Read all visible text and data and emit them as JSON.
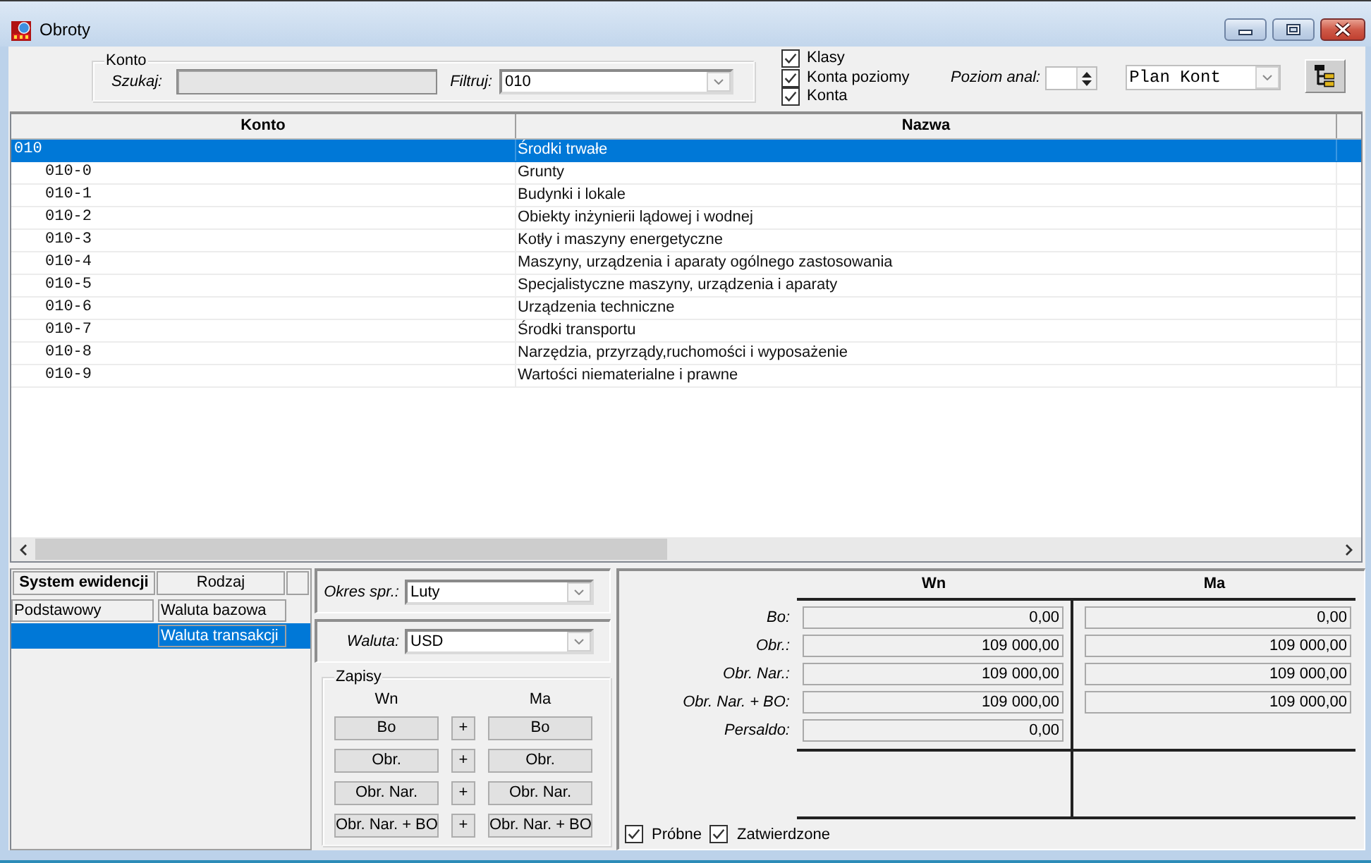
{
  "window": {
    "title": "Obroty"
  },
  "filter_bar": {
    "group": "Konto",
    "search": {
      "label": "Szukaj:",
      "disabled": true
    },
    "filter": {
      "label": "Filtruj:",
      "value": "010"
    },
    "checkboxes": [
      {
        "label": "Klasy",
        "checked": true
      },
      {
        "label": "Konta poziomy",
        "checked": true
      },
      {
        "label": "Konta",
        "checked": true
      }
    ],
    "analysis_level": {
      "label": "Poziom anal:"
    },
    "plan_select": {
      "value": "Plan Kont"
    }
  },
  "table": {
    "columns": [
      "Konto",
      "Nazwa"
    ],
    "rows": [
      {
        "account": "010",
        "name": "Środki trwałe",
        "selected": true,
        "children": [
          {
            "account": "010-0",
            "name": "Grunty",
            "selected": false
          },
          {
            "account": "010-1",
            "name": "Budynki i lokale",
            "selected": false
          },
          {
            "account": "010-2",
            "name": "Obiekty inżynierii lądowej i wodnej",
            "selected": false
          },
          {
            "account": "010-3",
            "name": "Kotły i maszyny energetyczne",
            "selected": false
          },
          {
            "account": "010-4",
            "name": "Maszyny, urządzenia i aparaty ogólnego zastosowania",
            "selected": false
          },
          {
            "account": "010-5",
            "name": "Specjalistyczne maszyny, urządzenia i aparaty",
            "selected": false
          },
          {
            "account": "010-6",
            "name": "Urządzenia techniczne",
            "selected": false
          },
          {
            "account": "010-7",
            "name": "Środki transportu",
            "selected": false
          },
          {
            "account": "010-8",
            "name": "Narzędzia, przyrządy,ruchomości i wyposażenie",
            "selected": false
          },
          {
            "account": "010-9",
            "name": "Wartości niematerialne i prawne",
            "selected": false
          }
        ]
      }
    ]
  },
  "record_systems": {
    "columns": [
      "System ewidencji",
      "Rodzaj"
    ],
    "rows": [
      {
        "system": "Podstawowy",
        "kinds": [
          {
            "label": "Waluta bazowa",
            "selected": false
          },
          {
            "label": "Waluta transakcji",
            "selected": true
          }
        ]
      }
    ]
  },
  "period": {
    "label": "Okres spr.:",
    "value": "Luty"
  },
  "currency": {
    "label": "Waluta:",
    "value": "USD"
  },
  "entries": {
    "title": "Zapisy",
    "columns": [
      "Wn",
      "Ma"
    ],
    "rows": [
      {
        "wn": "Bo",
        "join": "+",
        "ma": "Bo"
      },
      {
        "wn": "Obr.",
        "join": "+",
        "ma": "Obr."
      },
      {
        "wn": "Obr. Nar.",
        "join": "+",
        "ma": "Obr. Nar."
      },
      {
        "wn": "Obr. Nar. + BO",
        "join": "+",
        "ma": "Obr. Nar. + BO"
      }
    ]
  },
  "totals": {
    "columns": [
      "Wn",
      "Ma"
    ],
    "rows": [
      {
        "label": "Bo:",
        "values": [
          "0,00",
          "0,00"
        ]
      },
      {
        "label": "Obr.:",
        "values": [
          "109 000,00",
          "109 000,00"
        ]
      },
      {
        "label": "Obr. Nar.:",
        "values": [
          "109 000,00",
          "109 000,00"
        ]
      },
      {
        "label": "Obr. Nar. + BO:",
        "values": [
          "109 000,00",
          "109 000,00"
        ]
      },
      {
        "label": "Persaldo:",
        "values": [
          "0,00"
        ]
      }
    ]
  },
  "options": [
    {
      "label": "Próbne",
      "checked": true
    },
    {
      "label": "Zatwierdzone",
      "checked": true
    }
  ]
}
